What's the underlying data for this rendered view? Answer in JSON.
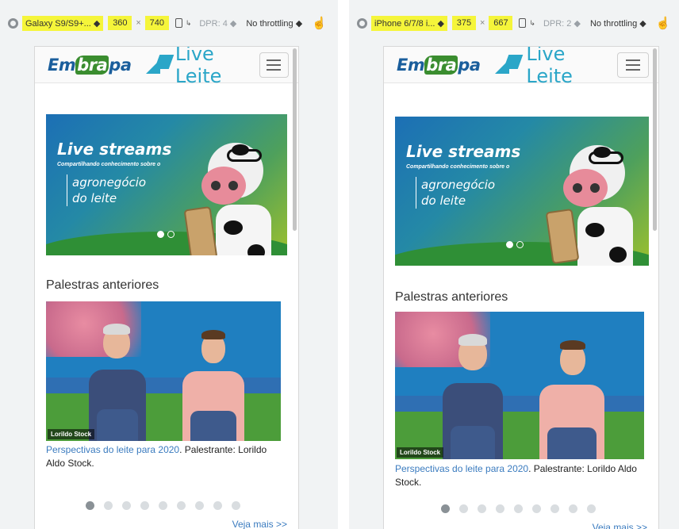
{
  "left": {
    "device_name": "Galaxy S9/S9+...",
    "width": "360",
    "height": "740",
    "dpr": "DPR: 4",
    "throttling": "No throttling",
    "brand": {
      "embrapa_pre": "Em",
      "embrapa_mid": "bra",
      "embrapa_post": "pa",
      "live": "Live Leite"
    },
    "hero": {
      "title": "Live streams",
      "subtitle": "Compartilhando conhecimento sobre o",
      "tag_line1": "agronegócio",
      "tag_line2": "do leite",
      "slides": 2,
      "active_slide": 1
    },
    "section_title": "Palestras anteriores",
    "video_caption": "Lorildo Stock",
    "description": {
      "link": "Perspectivas do leite para 2020",
      "text": ". Palestrante: Lorildo Aldo Stock."
    },
    "pager": {
      "count": 9,
      "active": 1
    },
    "more": "Veja mais >>"
  },
  "right": {
    "device_name": "iPhone 6/7/8 i...",
    "width": "375",
    "height": "667",
    "dpr": "DPR: 2",
    "throttling": "No throttling",
    "brand": {
      "embrapa_pre": "Em",
      "embrapa_mid": "bra",
      "embrapa_post": "pa",
      "live": "Live Leite"
    },
    "hero": {
      "title": "Live streams",
      "subtitle": "Compartilhando conhecimento sobre o",
      "tag_line1": "agronegócio",
      "tag_line2": "do leite",
      "slides": 2,
      "active_slide": 1
    },
    "section_title": "Palestras anteriores",
    "video_caption": "Lorildo Stock",
    "description": {
      "link": "Perspectivas do leite para 2020",
      "text": ". Palestrante: Lorildo Aldo Stock."
    },
    "pager": {
      "count": 9,
      "active": 1
    },
    "more": "Veja mais >>"
  },
  "colors": {
    "highlight": "#f5f53a",
    "link": "#3a7bbf",
    "embrapa_blue": "#1a5e9c",
    "embrapa_green": "#3a8d2f",
    "live_cyan": "#2aa6c8"
  },
  "icons": {
    "devtools": "chrome-icon",
    "rotate": "rotate-device-icon",
    "touch": "touch-hand-icon",
    "menu": "hamburger-menu-icon"
  }
}
